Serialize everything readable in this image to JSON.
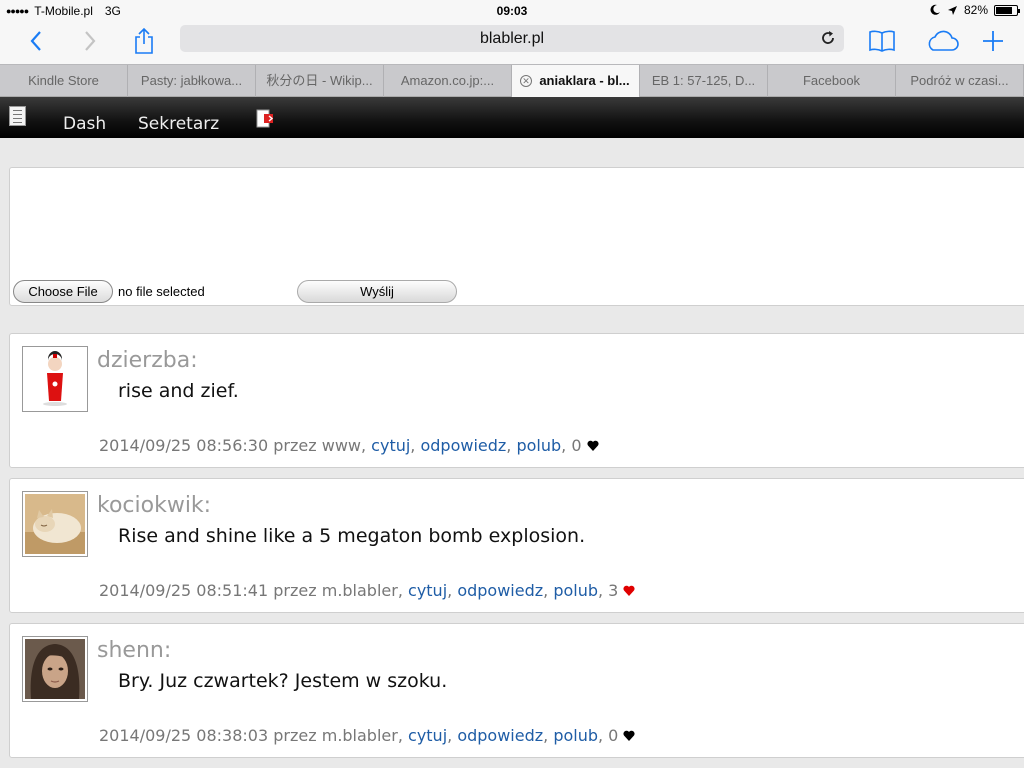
{
  "status_bar": {
    "carrier": "T-Mobile.pl",
    "network": "3G",
    "time": "09:03",
    "battery": "82%"
  },
  "browser": {
    "url": "blabler.pl",
    "tabs": [
      {
        "label": "Kindle Store"
      },
      {
        "label": "Pasty: jabłkowa..."
      },
      {
        "label": "秋分の日 - Wikip..."
      },
      {
        "label": "Amazon.co.jp:..."
      },
      {
        "label": "aniaklara - bl...",
        "active": true
      },
      {
        "label": "EB 1: 57-125, D..."
      },
      {
        "label": "Facebook"
      },
      {
        "label": "Podróż w czasi..."
      }
    ],
    "icons": [
      "back-icon",
      "forward-icon",
      "share-icon",
      "reload-icon",
      "bookmarks-icon",
      "icloud-tabs-icon",
      "new-tab-icon"
    ]
  },
  "site_nav": {
    "items": [
      {
        "label": "Dash"
      },
      {
        "label": "Sekretarz"
      }
    ]
  },
  "compose": {
    "choose_file_label": "Choose File",
    "file_status": "no file selected",
    "send_label": "Wyślij"
  },
  "posts": [
    {
      "author": "dzierzba:",
      "text": "rise and zief.",
      "timestamp": "2014/09/25 08:56:30",
      "via": "przez www,",
      "quote": "cytuj",
      "reply": "odpowiedz",
      "like": "polub",
      "likes": "0",
      "heart_color": "#000000"
    },
    {
      "author": "kociokwik:",
      "text": "Rise and shine like a 5 megaton bomb explosion.",
      "timestamp": "2014/09/25 08:51:41",
      "via": "przez m.blabler,",
      "quote": "cytuj",
      "reply": "odpowiedz",
      "like": "polub",
      "likes": "3",
      "heart_color": "#e00000"
    },
    {
      "author": "shenn:",
      "text": "Bry. Juz czwartek? Jestem w szoku.",
      "timestamp": "2014/09/25 08:38:03",
      "via": "przez m.blabler,",
      "quote": "cytuj",
      "reply": "odpowiedz",
      "like": "polub",
      "likes": "0",
      "heart_color": "#000000"
    }
  ],
  "colors": {
    "link": "#1f5da6",
    "ios_blue": "#1a7cf5",
    "nav_bar": "#111111"
  }
}
